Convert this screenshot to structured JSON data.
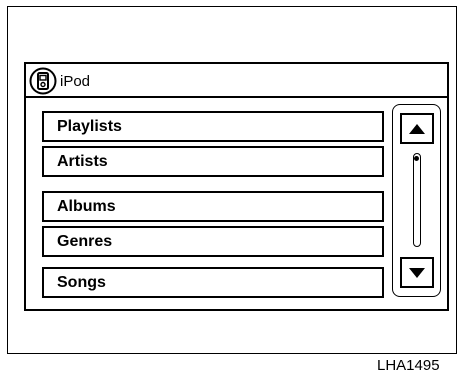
{
  "header": {
    "icon": "ipod-icon",
    "title": "iPod"
  },
  "menu": {
    "items": [
      {
        "label": "Playlists"
      },
      {
        "label": "Artists"
      },
      {
        "label": "Albums"
      },
      {
        "label": "Genres"
      },
      {
        "label": "Songs"
      }
    ]
  },
  "scrollbar": {
    "up_icon": "triangle-up-icon",
    "down_icon": "triangle-down-icon"
  },
  "figure_code": "LHA1495"
}
